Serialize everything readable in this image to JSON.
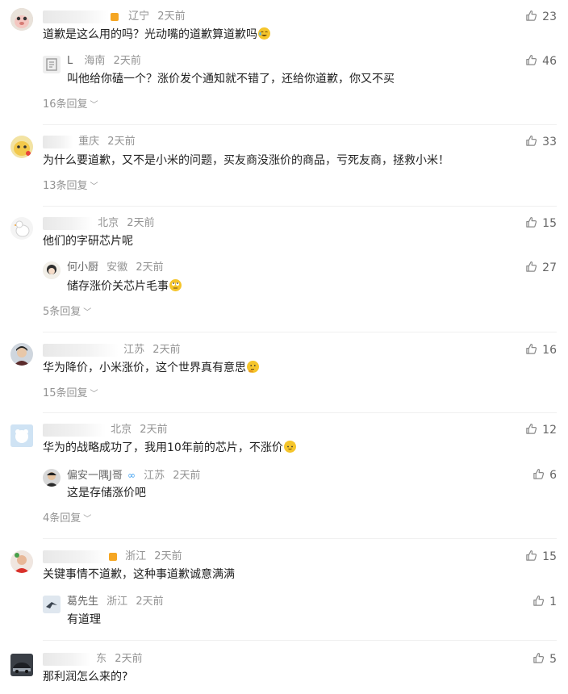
{
  "time_ago": "2天前",
  "like_icon": "thumbs-up-icon",
  "expand_icon": "chevron-down-icon",
  "comments": [
    {
      "region": "辽宁",
      "text": "道歉是这么用的吗？光动嘴的道歉算道歉吗",
      "likes": "23",
      "reply": {
        "user": "L",
        "region": "海南",
        "text": "叫他给你磕一个？涨价发个通知就不错了，还给你道歉，你又不买",
        "likes": "46"
      },
      "replies_label": "16条回复"
    },
    {
      "region": "重庆",
      "text": "为什么要道歉，又不是小米的问题，买友商没涨价的商品，亏死友商，拯救小米！",
      "likes": "33",
      "replies_label": "13条回复"
    },
    {
      "region": "北京",
      "text": "他们的字研芯片呢",
      "likes": "15",
      "reply": {
        "user": "何小厨",
        "region": "安徽",
        "text": "储存涨价关芯片毛事",
        "likes": "27"
      },
      "replies_label": "5条回复"
    },
    {
      "region": "江苏",
      "text": "华为降价，小米涨价，这个世界真有意思",
      "likes": "16",
      "replies_label": "15条回复"
    },
    {
      "region": "北京",
      "text": "华为的战略成功了，我用10年前的芯片，不涨价",
      "likes": "12",
      "reply": {
        "user": "偏安一隅J哥",
        "region": "江苏",
        "text": "这是存储涨价吧",
        "likes": "6"
      },
      "replies_label": "4条回复"
    },
    {
      "region": "浙江",
      "text": "关键事情不道歉，这种事道歉诚意满满",
      "likes": "15",
      "reply": {
        "user": "葛先生",
        "region": "浙江",
        "text": "有道理",
        "likes": "1"
      }
    },
    {
      "region": "东",
      "text": "那利润怎么来的?",
      "likes": "5"
    }
  ]
}
